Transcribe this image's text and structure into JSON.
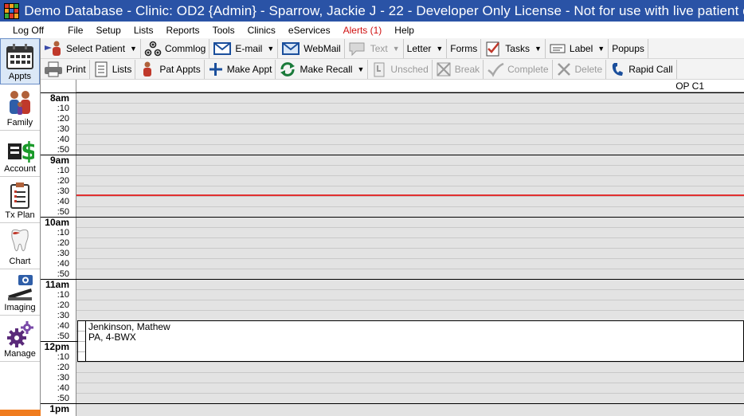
{
  "window": {
    "title": "Demo Database - Clinic: OD2 {Admin} - Sparrow, Jackie J - 22 - Developer Only License - Not for use with live patient data"
  },
  "menu": [
    "Log Off",
    "File",
    "Setup",
    "Lists",
    "Reports",
    "Tools",
    "Clinics",
    "eServices",
    "Alerts (1)",
    "Help"
  ],
  "modules": [
    {
      "label": "Appts",
      "icon": "calendar-icon"
    },
    {
      "label": "Family",
      "icon": "family-icon"
    },
    {
      "label": "Account",
      "icon": "dollar-icon"
    },
    {
      "label": "Tx Plan",
      "icon": "clipboard-icon"
    },
    {
      "label": "Chart",
      "icon": "tooth-icon"
    },
    {
      "label": "Imaging",
      "icon": "camera-icon"
    },
    {
      "label": "Manage",
      "icon": "gears-icon"
    }
  ],
  "toolbar1": [
    "Select Patient",
    "Commlog",
    "E-mail",
    "WebMail",
    "Text",
    "Letter",
    "Forms",
    "Tasks",
    "Label",
    "Popups"
  ],
  "toolbar2": [
    "Print",
    "Lists",
    "Pat Appts",
    "Make Appt",
    "Make Recall",
    "Unsched",
    "Break",
    "Complete",
    "Delete",
    "Rapid Call"
  ],
  "schedule": {
    "operatory": "OP C1",
    "times": [
      {
        "hour": "8am",
        "subs": [
          ":10",
          ":20",
          ":30",
          ":40",
          ":50"
        ]
      },
      {
        "hour": "9am",
        "subs": [
          ":10",
          ":20",
          ":30",
          ":40",
          ":50"
        ]
      },
      {
        "hour": "10am",
        "subs": [
          ":10",
          ":20",
          ":30",
          ":40",
          ":50"
        ]
      },
      {
        "hour": "11am",
        "subs": [
          ":10",
          ":20",
          ":30",
          ":40",
          ":50"
        ]
      },
      {
        "hour": "12pm",
        "subs": [
          ":10",
          ":20",
          ":30",
          ":40",
          ":50"
        ]
      },
      {
        "hour": "1pm",
        "subs": []
      }
    ],
    "appointment": {
      "patient": "Jenkinson, Mathew",
      "details": "PA, 4-BWX"
    }
  },
  "colors": {
    "titlebar": "#2a53a6",
    "alert": "#d01010",
    "timeline": "#e23030",
    "module_strip": "#f07c1e"
  }
}
